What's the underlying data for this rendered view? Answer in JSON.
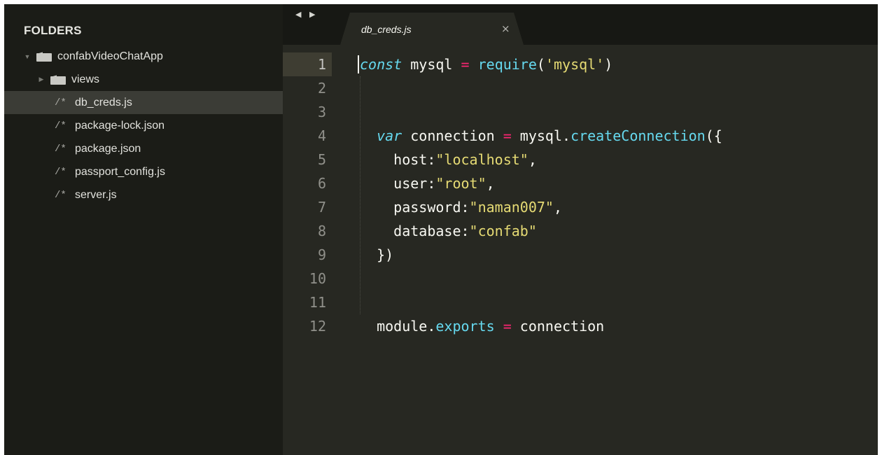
{
  "sidebar": {
    "header": "FOLDERS",
    "project": {
      "name": "confabVideoChatApp",
      "expanded": true
    },
    "items": [
      {
        "type": "folder",
        "label": "views",
        "icon": "folder-icon",
        "expanded": false
      },
      {
        "type": "file",
        "label": "db_creds.js",
        "icon": "/*",
        "selected": true
      },
      {
        "type": "file",
        "label": "package-lock.json",
        "icon": "/*"
      },
      {
        "type": "file",
        "label": "package.json",
        "icon": "/*"
      },
      {
        "type": "file",
        "label": "passport_config.js",
        "icon": "/*"
      },
      {
        "type": "file",
        "label": "server.js",
        "icon": "/*"
      }
    ]
  },
  "tabbar": {
    "nav_arrows": "◀ ▶",
    "active_tab": {
      "label": "db_creds.js",
      "close_glyph": "×"
    }
  },
  "editor": {
    "current_line": 1,
    "line_numbers": [
      "1",
      "2",
      "3",
      "4",
      "5",
      "6",
      "7",
      "8",
      "9",
      "10",
      "11",
      "12"
    ],
    "lines": [
      [
        {
          "t": "const",
          "c": "kw"
        },
        {
          "t": " mysql ",
          "c": "plain"
        },
        {
          "t": "=",
          "c": "op"
        },
        {
          "t": " ",
          "c": "plain"
        },
        {
          "t": "require",
          "c": "fn"
        },
        {
          "t": "(",
          "c": "plain"
        },
        {
          "t": "'mysql'",
          "c": "str"
        },
        {
          "t": ")",
          "c": "plain"
        }
      ],
      [],
      [],
      [
        {
          "t": "  ",
          "c": "plain"
        },
        {
          "t": "var",
          "c": "kw"
        },
        {
          "t": " connection ",
          "c": "plain"
        },
        {
          "t": "=",
          "c": "op"
        },
        {
          "t": " mysql.",
          "c": "plain"
        },
        {
          "t": "createConnection",
          "c": "fn"
        },
        {
          "t": "({",
          "c": "plain"
        }
      ],
      [
        {
          "t": "    host:",
          "c": "plain"
        },
        {
          "t": "\"localhost\"",
          "c": "str"
        },
        {
          "t": ",",
          "c": "plain"
        }
      ],
      [
        {
          "t": "    user:",
          "c": "plain"
        },
        {
          "t": "\"root\"",
          "c": "str"
        },
        {
          "t": ",",
          "c": "plain"
        }
      ],
      [
        {
          "t": "    password:",
          "c": "plain"
        },
        {
          "t": "\"naman007\"",
          "c": "str"
        },
        {
          "t": ",",
          "c": "plain"
        }
      ],
      [
        {
          "t": "    database:",
          "c": "plain"
        },
        {
          "t": "\"confab\"",
          "c": "str"
        }
      ],
      [
        {
          "t": "  })",
          "c": "plain"
        }
      ],
      [],
      [],
      [
        {
          "t": "  module.",
          "c": "plain"
        },
        {
          "t": "exports",
          "c": "fn"
        },
        {
          "t": " ",
          "c": "plain"
        },
        {
          "t": "=",
          "c": "op"
        },
        {
          "t": " connection",
          "c": "plain"
        }
      ]
    ]
  },
  "colors": {
    "sidebar_bg": "#1b1c17",
    "editor_bg": "#272822",
    "keyword": "#66d9ef",
    "operator": "#f92672",
    "string": "#e6db74",
    "text": "#f8f8f2"
  }
}
